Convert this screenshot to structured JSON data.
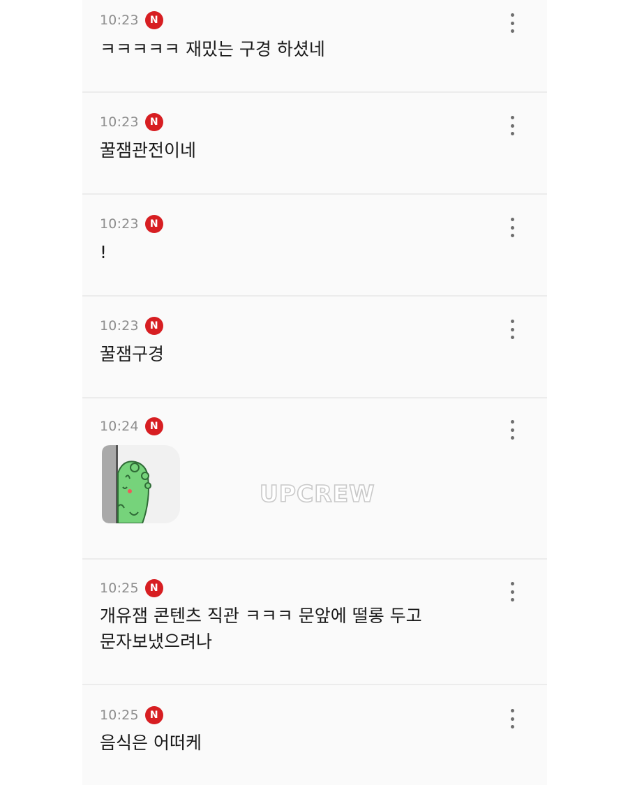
{
  "comments": [
    {
      "time": "10:23",
      "badge": "N",
      "text": "ㅋㅋㅋㅋㅋ 재밌는 구경 하셨네"
    },
    {
      "time": "10:23",
      "badge": "N",
      "text": "꿀잼관전이네"
    },
    {
      "time": "10:23",
      "badge": "N",
      "text": "!"
    },
    {
      "time": "10:23",
      "badge": "N",
      "text": "꿀잼구경"
    },
    {
      "time": "10:24",
      "badge": "N",
      "sticker": "peeking-green-dinosaur-sticker"
    },
    {
      "time": "10:25",
      "badge": "N",
      "text": "개유잼 콘텐츠 직관 ㅋㅋㅋ 문앞에 떨롱 두고 문자보냈으려나"
    },
    {
      "time": "10:25",
      "badge": "N",
      "text": "음식은 어떠케"
    }
  ],
  "watermark": "UPCREW",
  "icons": {
    "more": "more-vertical-icon",
    "badge_color": "#d71e22"
  }
}
